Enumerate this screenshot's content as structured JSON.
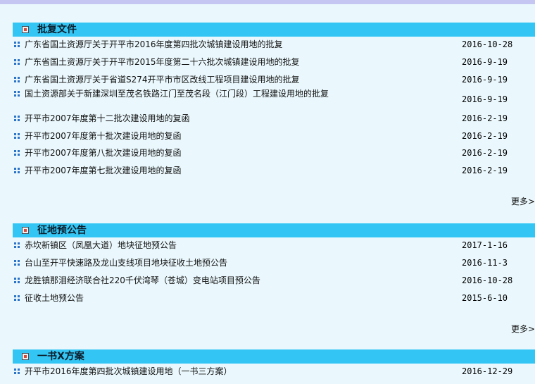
{
  "sections": [
    {
      "title": "批复文件",
      "more_label": "更多>",
      "items": [
        {
          "title": "广东省国土资源厅关于开平市2016年度第四批次城镇建设用地的批复",
          "date": "2016-10-28"
        },
        {
          "title": "广东省国土资源厅关于开平市2015年度第二十六批次城镇建设用地的批复",
          "date": "2016-9-19"
        },
        {
          "title": "广东省国土资源厅关于省道S274开平市市区改线工程项目建设用地的批复",
          "date": "2016-9-19"
        },
        {
          "title": "国土资源部关于新建深圳至茂名铁路江门至茂名段（江门段）工程建设用地的批复",
          "date": "2016-9-19"
        },
        {
          "title": "开平市2007年度第十二批次建设用地的复函",
          "date": "2016-2-19"
        },
        {
          "title": "开平市2007年度第十批次建设用地的复函",
          "date": "2016-2-19"
        },
        {
          "title": "开平市2007年度第八批次建设用地的复函",
          "date": "2016-2-19"
        },
        {
          "title": "开平市2007年度第七批次建设用地的复函",
          "date": "2016-2-19"
        }
      ]
    },
    {
      "title": "征地预公告",
      "more_label": "更多>",
      "items": [
        {
          "title": "赤坎新镇区（凤凰大道）地块征地预公告",
          "date": "2017-1-16"
        },
        {
          "title": "台山至开平快速路及龙山支线项目地块征收土地预公告",
          "date": "2016-11-3"
        },
        {
          "title": "龙胜镇那泪经济联合社220千伏湾琴（苍城）变电站项目预公告",
          "date": "2016-10-28"
        },
        {
          "title": "征收土地预公告",
          "date": "2015-6-10"
        }
      ]
    },
    {
      "title": "一书X方案",
      "items": [
        {
          "title": "开平市2016年度第四批次城镇建设用地（一书三方案）",
          "date": "2016-12-29"
        }
      ]
    }
  ]
}
